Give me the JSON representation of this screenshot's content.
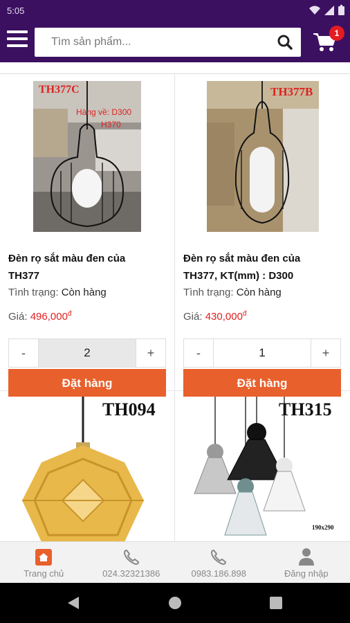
{
  "status": {
    "time": "5:05"
  },
  "search": {
    "placeholder": "Tìm sản phẩm..."
  },
  "cart": {
    "count": "1"
  },
  "products": [
    {
      "tag": "TH377C",
      "note1": "Hàng về: D300",
      "note2": "H370",
      "name_line1": "Đèn rọ sắt màu đen của",
      "name_line2": "TH377",
      "stock_label": "Tình trạng:",
      "stock_value": "Còn hàng",
      "price_label": "Giá:",
      "price_value": "496,000",
      "currency": "đ",
      "qty_minus": "-",
      "qty": "2",
      "qty_plus": "+",
      "order_label": "Đặt hàng"
    },
    {
      "tag": "TH377B",
      "name_line1": "Đèn rọ sắt màu đen của",
      "name_line2": "TH377, KT(mm) : D300",
      "stock_label": "Tình trạng:",
      "stock_value": "Còn hàng",
      "price_label": "Giá:",
      "price_value": "430,000",
      "currency": "đ",
      "qty_minus": "-",
      "qty": "1",
      "qty_plus": "+",
      "order_label": "Đặt hàng"
    },
    {
      "tag": "TH094"
    },
    {
      "tag": "TH315",
      "dims": "190x290"
    }
  ],
  "bottom_nav": [
    {
      "label": "Trang chủ",
      "icon": "home-icon"
    },
    {
      "label": "024.32321386",
      "icon": "phone-icon"
    },
    {
      "label": "0983.186.898",
      "icon": "phone-icon"
    },
    {
      "label": "Đăng nhập",
      "icon": "user-icon"
    }
  ],
  "colors": {
    "primary": "#3b1060",
    "accent": "#e8602c",
    "price": "#e02020",
    "badge": "#e31b23"
  }
}
